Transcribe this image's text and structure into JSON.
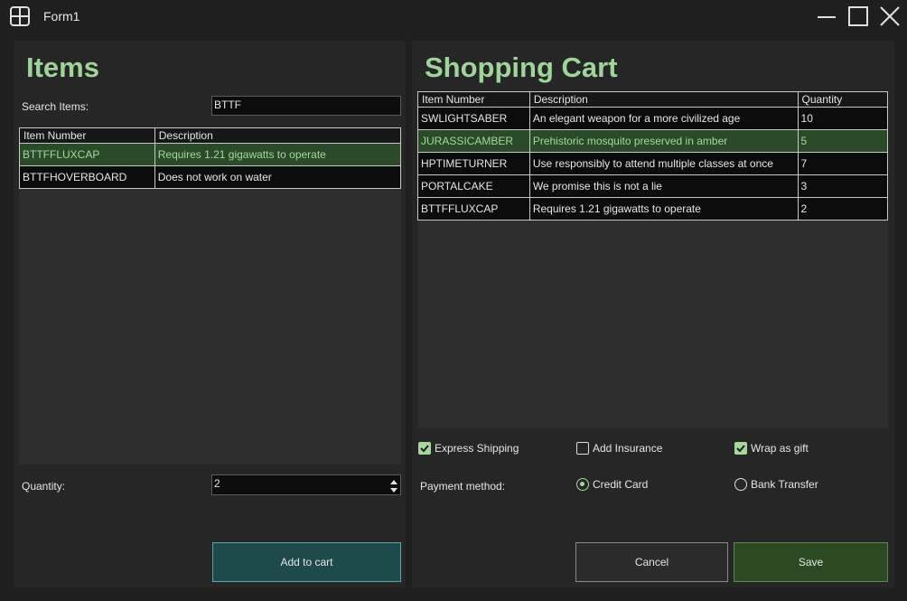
{
  "window": {
    "title": "Form1",
    "icon": "grid-app-icon",
    "controls": [
      "minimize-icon",
      "maximize-icon",
      "close-icon"
    ]
  },
  "items_panel": {
    "heading": "Items",
    "search_label": "Search Items:",
    "search_value": "BTTF",
    "columns": [
      "Item Number",
      "Description"
    ],
    "rows": [
      {
        "item_number": "BTTFFLUXCAP",
        "description": "Requires 1.21 gigawatts to operate",
        "selected": true
      },
      {
        "item_number": "BTTFHOVERBOARD",
        "description": "Does not work on water",
        "selected": false
      }
    ],
    "quantity_label": "Quantity:",
    "quantity_value": "2",
    "add_button": "Add to cart"
  },
  "cart_panel": {
    "heading": "Shopping Cart",
    "columns": [
      "Item Number",
      "Description",
      "Quantity"
    ],
    "rows": [
      {
        "item_number": "SWLIGHTSABER",
        "description": "An elegant weapon for a more civilized age",
        "quantity": "10",
        "selected": false
      },
      {
        "item_number": "JURASSICAMBER",
        "description": "Prehistoric mosquito preserved in amber",
        "quantity": "5",
        "selected": true
      },
      {
        "item_number": "HPTIMETURNER",
        "description": "Use responsibly to attend multiple classes at once",
        "quantity": "7",
        "selected": false
      },
      {
        "item_number": "PORTALCAKE",
        "description": "We promise this is not a lie",
        "quantity": "3",
        "selected": false
      },
      {
        "item_number": "BTTFFLUXCAP",
        "description": "Requires 1.21 gigawatts to operate",
        "quantity": "2",
        "selected": false
      }
    ],
    "options": {
      "express_shipping": {
        "label": "Express Shipping",
        "checked": true
      },
      "add_insurance": {
        "label": "Add Insurance",
        "checked": false
      },
      "wrap_as_gift": {
        "label": "Wrap as gift",
        "checked": true
      }
    },
    "payment_label": "Payment method:",
    "payment": {
      "credit_card": {
        "label": "Credit Card",
        "selected": true
      },
      "bank_transfer": {
        "label": "Bank Transfer",
        "selected": false
      }
    },
    "cancel_button": "Cancel",
    "save_button": "Save"
  },
  "colors": {
    "accent": "#9fd49a",
    "selection_bg": "#2a4a2a",
    "add_button_bg": "#1e4a4c",
    "save_button_bg": "#2b4a24"
  }
}
